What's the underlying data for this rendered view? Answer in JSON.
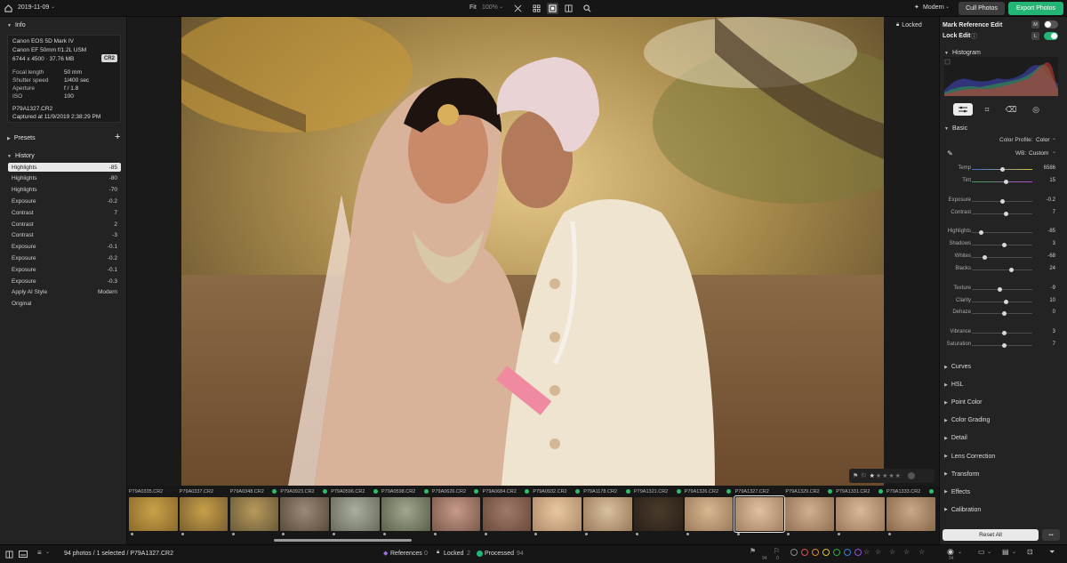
{
  "topbar": {
    "folder": "2019-11-09",
    "fit": "Fit",
    "zoom": "100%",
    "style": "Modern",
    "cull_button": "Cull Photos",
    "export_button": "Export Photos",
    "accent": "#22b573"
  },
  "info": {
    "title": "Info",
    "camera": "Canon EOS 5D Mark IV",
    "lens": "Canon EF 50mm f/1.2L USM",
    "dims": "6744 x 4500 · 37.76 MB",
    "format": "CR2",
    "rows": [
      {
        "k": "Focal length",
        "v": "50 mm"
      },
      {
        "k": "Shutter speed",
        "v": "1/400 sec"
      },
      {
        "k": "Aperture",
        "v": "f / 1.8"
      },
      {
        "k": "ISO",
        "v": "100"
      }
    ],
    "filename": "P79A1327.CR2",
    "captured": "Captured at 11/9/2019 2:38:29 PM"
  },
  "presets": {
    "title": "Presets",
    "add": "+"
  },
  "history": {
    "title": "History",
    "items": [
      {
        "label": "Highlights",
        "value": "-85"
      },
      {
        "label": "Highlights",
        "value": "-80"
      },
      {
        "label": "Highlights",
        "value": "-70"
      },
      {
        "label": "Exposure",
        "value": "-0.2"
      },
      {
        "label": "Contrast",
        "value": "7"
      },
      {
        "label": "Contrast",
        "value": "2"
      },
      {
        "label": "Contrast",
        "value": "-3"
      },
      {
        "label": "Exposure",
        "value": "-0.1"
      },
      {
        "label": "Exposure",
        "value": "-0.2"
      },
      {
        "label": "Exposure",
        "value": "-0.1"
      },
      {
        "label": "Exposure",
        "value": "-0.3"
      },
      {
        "label": "Apply AI Style",
        "value": "Modern"
      },
      {
        "label": "Original",
        "value": ""
      }
    ]
  },
  "viewer": {
    "locked": "Locked"
  },
  "right": {
    "mark_ref": "Mark Reference Edit",
    "mark_key": "M",
    "lock_edit": "Lock Edit",
    "lock_key": "L",
    "histogram": "Histogram",
    "basic": "Basic",
    "color_profile_label": "Color Profile:",
    "color_profile_value": "Color",
    "wb_label": "WB:",
    "wb_value": "Custom",
    "sliders": [
      {
        "label": "Temp",
        "value": "6586",
        "pos": 0.5
      },
      {
        "label": "Tint",
        "value": "15",
        "pos": 0.57
      },
      {
        "label": "Exposure",
        "value": "-0.2",
        "pos": 0.5
      },
      {
        "label": "Contrast",
        "value": "7",
        "pos": 0.56
      },
      {
        "label": "Highlights",
        "value": "-85",
        "pos": 0.15
      },
      {
        "label": "Shadows",
        "value": "3",
        "pos": 0.53
      },
      {
        "label": "Whites",
        "value": "-68",
        "pos": 0.22
      },
      {
        "label": "Blacks",
        "value": "24",
        "pos": 0.66
      },
      {
        "label": "Texture",
        "value": "-9",
        "pos": 0.47
      },
      {
        "label": "Clarity",
        "value": "10",
        "pos": 0.56
      },
      {
        "label": "Dehaze",
        "value": "0",
        "pos": 0.53
      },
      {
        "label": "Vibrance",
        "value": "3",
        "pos": 0.53
      },
      {
        "label": "Saturation",
        "value": "7",
        "pos": 0.54
      }
    ],
    "sections": [
      "Curves",
      "HSL",
      "Point Color",
      "Color Grading",
      "Detail",
      "Lens Correction",
      "Transform",
      "Effects",
      "Calibration"
    ],
    "reset": "Reset All",
    "more": "•••"
  },
  "filmstrip": {
    "thumbs": [
      {
        "name": "P79A0335.CR2",
        "proc": false
      },
      {
        "name": "P79A0337.CR2",
        "proc": false
      },
      {
        "name": "P79A0348.CR2",
        "proc": true
      },
      {
        "name": "P79A0923.CR2",
        "proc": true
      },
      {
        "name": "P79A0596.CR2",
        "proc": true
      },
      {
        "name": "P79A0598.CR2",
        "proc": true
      },
      {
        "name": "P79A0626.CR2",
        "proc": true
      },
      {
        "name": "P79A0684.CR2",
        "proc": true
      },
      {
        "name": "P79A0932.CR2",
        "proc": true
      },
      {
        "name": "P79A1178.CR2",
        "proc": true
      },
      {
        "name": "P79A1321.CR2",
        "proc": true
      },
      {
        "name": "P79A1326.CR2",
        "proc": true
      },
      {
        "name": "P79A1327.CR2",
        "proc": false
      },
      {
        "name": "P79A1329.CR2",
        "proc": true
      },
      {
        "name": "P79A1331.CR2",
        "proc": true
      },
      {
        "name": "P79A1333.CR2",
        "proc": true
      }
    ]
  },
  "status": {
    "count": "94 photos / 1 selected / P79A1327.CR2",
    "references": "References",
    "references_n": "0",
    "locked": "Locked",
    "locked_n": "2",
    "processed": "Processed",
    "processed_n": "94",
    "flag_n1": "94",
    "flag_n2": "0",
    "view_n": "94"
  }
}
